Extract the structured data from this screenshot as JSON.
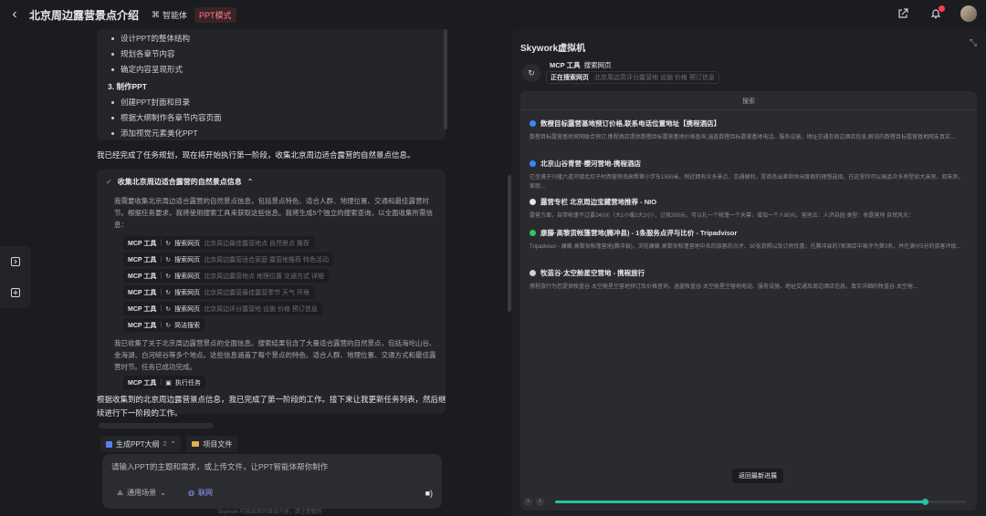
{
  "header": {
    "title": "北京周边露营景点介绍",
    "agent_label": "智能体",
    "mode_label": "PPT模式"
  },
  "plan": {
    "items_top": [
      "设计PPT的整体结构",
      "规划各章节内容",
      "确定内容呈现形式"
    ],
    "section3": "3. 制作PPT",
    "items_section3": [
      "创建PPT封面和目录",
      "根据大纲制作各章节内容页面",
      "添加视觉元素美化PPT"
    ]
  },
  "messages": {
    "stage1": "我已经完成了任务规划，现在将开始执行第一阶段，收集北京周边适合露营的自然景点信息。",
    "stage1_done": "根据收集到的北京周边露营景点信息，我已完成了第一阶段的工作。接下来让我更新任务列表，然后继续进行下一阶段的工作。"
  },
  "task": {
    "title": "收集北京周边适合露营的自然景点信息",
    "desc": "我需要收集北京周边适合露营的自然景点信息，包括景点特色、适合人群、地理位置、交通和最佳露营时节。根据任务要求，我将使用搜索工具来获取这些信息。我将生成5个独立的搜索查询，以全面收集所需信息：",
    "tools": [
      {
        "mcp": "MCP 工具",
        "action": "搜索网页",
        "query": "北京周边最佳露营地点 自然景点 推荐"
      },
      {
        "mcp": "MCP 工具",
        "action": "搜索网页",
        "query": "北京周边露营适合家庭 露营地推荐 特色活动"
      },
      {
        "mcp": "MCP 工具",
        "action": "搜索网页",
        "query": "北京周边露营地点 地理位置 交通方式 详细"
      },
      {
        "mcp": "MCP 工具",
        "action": "搜索网页",
        "query": "北京周边露营最佳露营季节 天气 环境"
      },
      {
        "mcp": "MCP 工具",
        "action": "搜索网页",
        "query": "北京周边评分露营地 设施 价格 预订信息"
      },
      {
        "mcp": "MCP 工具",
        "action": "简洁搜索",
        "query": ""
      }
    ],
    "result": "我已收集了关于北京周边露营景点的全面信息。搜索结果包含了大量适合露营的自然景点，包括海坨山谷、金海湖、白河峡谷等多个地点。这些信息涵盖了每个景点的特色、适合人群、地理位置、交通方式和最佳露营时节。任务已成功完成。",
    "exec": {
      "mcp": "MCP 工具",
      "action": "执行任务"
    }
  },
  "composer": {
    "ppt_outline": "生成PPT大纲",
    "ppt_outline_count": "2",
    "project_files": "项目文件",
    "placeholder": "请输入PPT的主题和需求，或上传文件，让PPT智能体帮你制作",
    "scene": "通用场景",
    "web": "联网"
  },
  "vm": {
    "title": "Skywork虚拟机",
    "tool_label": "MCP 工具",
    "tool_action": "搜索网页",
    "status": "正在搜索网页",
    "status_query": "北京周边高评分露营地 设施 价格 预订信息",
    "browser_title": "搜索",
    "results": [
      {
        "title": "数橙目标露营基地预订价格,联系电话位置地址【携程酒店】",
        "snippet": "数橙目标露营基地官网联合预订,携程酒店提供数橙目标露营基地价格查询,涵盖数橙目标露营基地电话、服务设施、地址交通及周边酒店信息,解说的数橙目标露营基地网友真实...",
        "color": "#3a86ff"
      },
      {
        "title": "北京山谷青营·樱河营地-携程酒店",
        "snippet": "它坐落于兴隆六道河镇北坎子村西营房南高帮第小学东1500米。附近拥有众多景点，交通便利，是商务出差和休闲度假的理想选择。在这里你可以高品众多房型如大床房、双床房、家庭...",
        "color": "#3a86ff"
      },
      {
        "title": "露营专栏 北京周边宝藏营地推荐 - NIO",
        "snippet": "露营方面，自带帐篷不过要240元（大1小暖2大2小），过夜260元。可以扎一个帐篷一个天幕，增加一个人80元。营地五：人济自园 类型：收露营地 自然风光：",
        "color": "#e6e7ea"
      },
      {
        "title": "康藤·高黎贡帐篷营地(腾冲县) - 1条服务点评与比价 - Tripadvisor",
        "snippet": "Tripadvisor - 康藤·高黎贡帐篷营地(腾冲县)，浏览康藤·高黎贡帐篷营地中名的旅客的点评、30张游照以及订房优惠；在腾冲县的7家酒店中被评为第3名，并在满分5分的旅客评级...",
        "color": "#34c759"
      },
      {
        "title": "牧蓝谷·太空舱星空营地 - 携程旅行",
        "snippet": "携程旅行为您提供牧蓝谷·太空舱星空营地预订及价格查询，涵盖牧蓝谷·太空舱星空营地电话、服务设施、地址交通及周边酒店信息。真实详细的牧蓝谷·太空舱...",
        "color": "#cfd0d4"
      }
    ],
    "back_latest": "返回最新进展",
    "progress": 0.9
  },
  "footer": "Skywork·可能出现的错误内容，请注意甄别",
  "icons": [
    "chevron-left-icon",
    "agent-icon",
    "share-icon",
    "bell-icon",
    "panel-icon",
    "plus-icon",
    "check-icon",
    "refresh-icon",
    "send-icon",
    "globe-icon"
  ]
}
